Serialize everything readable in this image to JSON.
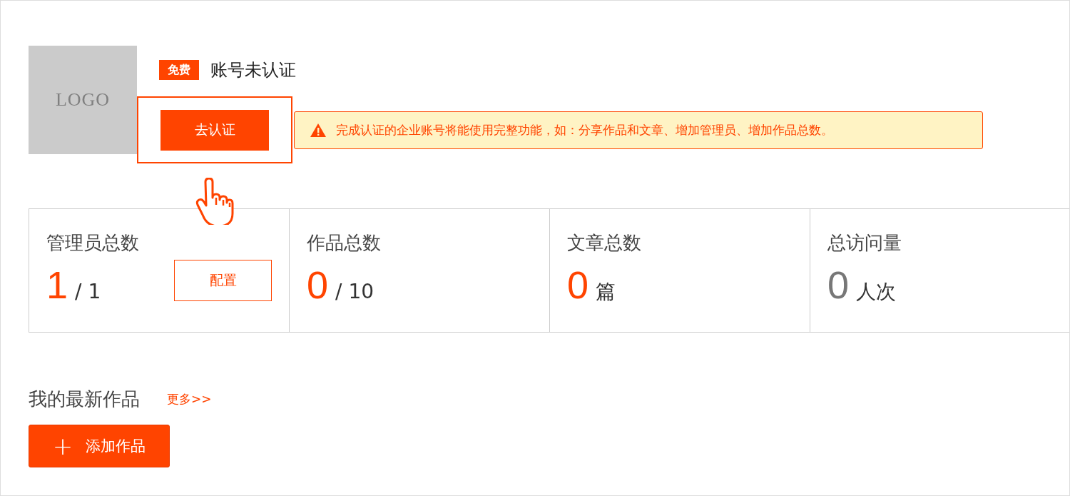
{
  "logo": {
    "text": "LOGO"
  },
  "account": {
    "badge": "免费",
    "status": "账号未认证"
  },
  "verify_button": {
    "label": "去认证",
    "highlighted": true
  },
  "notice": {
    "text": "完成认证的企业账号将能使用完整功能，如：分享作品和文章、增加管理员、增加作品总数。"
  },
  "stats": [
    {
      "label": "管理员总数",
      "value": "1",
      "unit": "/ 1",
      "color": "#ff4400",
      "action": "配置"
    },
    {
      "label": "作品总数",
      "value": "0",
      "unit": "/ 10",
      "color": "#ff4400"
    },
    {
      "label": "文章总数",
      "value": "0",
      "unit": "篇",
      "color": "#ff4400"
    },
    {
      "label": "总访问量",
      "value": "0",
      "unit": "人次",
      "color": "#777777"
    }
  ],
  "works": {
    "title": "我的最新作品",
    "more": "更多>>",
    "add_button": {
      "icon": "+",
      "label": "添加作品"
    }
  }
}
